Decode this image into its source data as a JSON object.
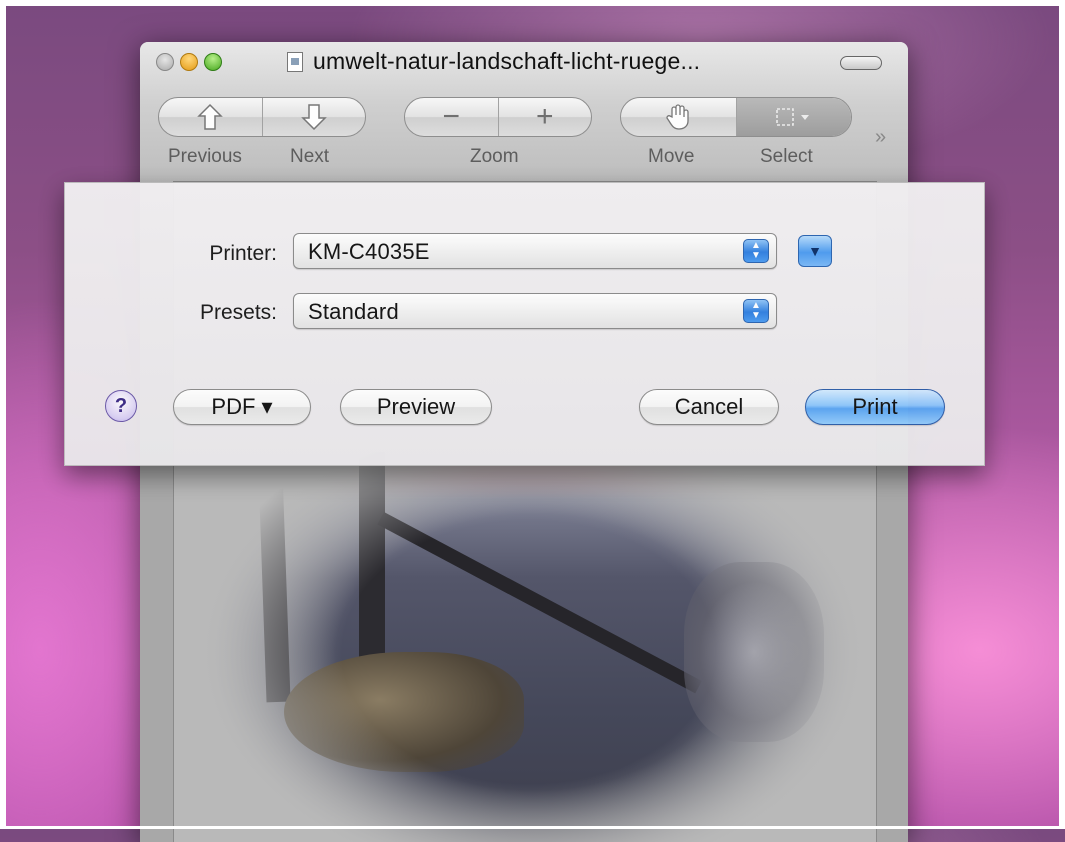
{
  "window": {
    "title": "umwelt-natur-landschaft-licht-ruege...",
    "toolbar": {
      "previous_label": "Previous",
      "next_label": "Next",
      "zoom_label": "Zoom",
      "move_label": "Move",
      "select_label": "Select",
      "zoom_out_glyph": "−",
      "zoom_in_glyph": "+",
      "overflow_glyph": "»"
    }
  },
  "print_dialog": {
    "printer_label": "Printer:",
    "printer_value": "KM-C4035E",
    "presets_label": "Presets:",
    "presets_value": "Standard",
    "help_glyph": "?",
    "pdf_label": "PDF ▾",
    "preview_label": "Preview",
    "cancel_label": "Cancel",
    "print_label": "Print",
    "disclosure_glyph": "▼"
  },
  "colors": {
    "default_button": "#5aa4f1",
    "desktop": "#b35aa6"
  }
}
